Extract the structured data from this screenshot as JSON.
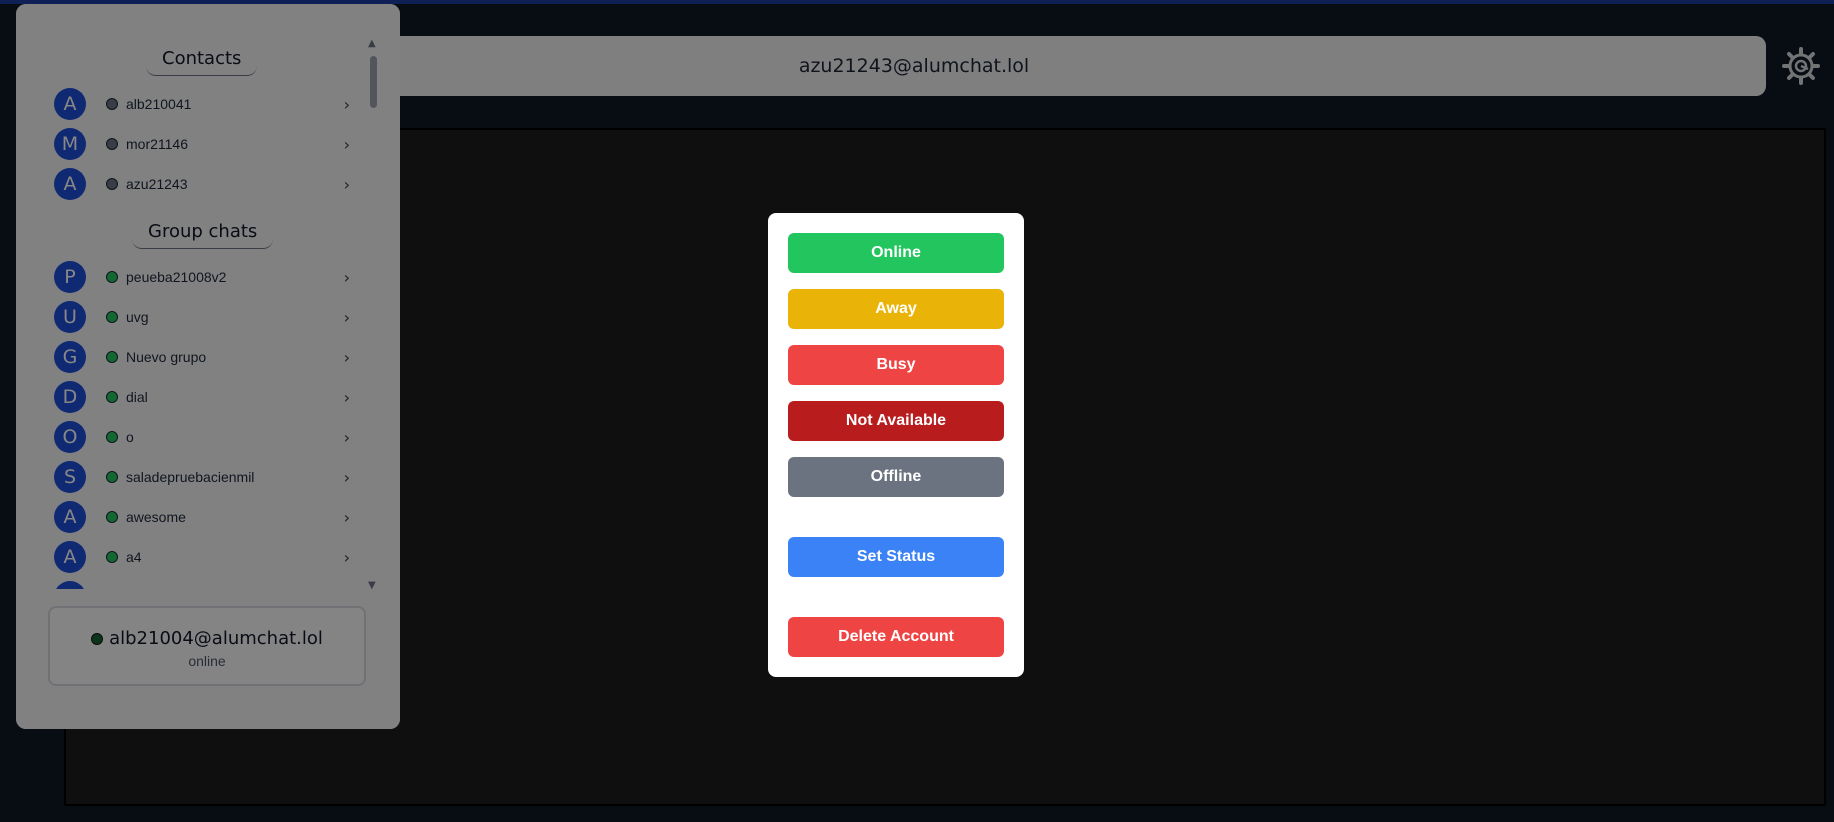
{
  "header": {
    "title": "azu21243@alumchat.lol"
  },
  "sidebar": {
    "contacts_title": "Contacts",
    "groups_title": "Group chats",
    "contacts": [
      {
        "initial": "A",
        "name": "alb210041",
        "status": "offline"
      },
      {
        "initial": "M",
        "name": "mor21146",
        "status": "offline"
      },
      {
        "initial": "A",
        "name": "azu21243",
        "status": "offline"
      }
    ],
    "groups": [
      {
        "initial": "P",
        "name": "peueba21008v2",
        "status": "online"
      },
      {
        "initial": "U",
        "name": "uvg",
        "status": "online"
      },
      {
        "initial": "G",
        "name": "Nuevo grupo",
        "status": "online"
      },
      {
        "initial": "D",
        "name": "dial",
        "status": "online"
      },
      {
        "initial": "O",
        "name": "o",
        "status": "online"
      },
      {
        "initial": "S",
        "name": "saladepruebacienmil",
        "status": "online"
      },
      {
        "initial": "A",
        "name": "awesome",
        "status": "online"
      },
      {
        "initial": "A",
        "name": "a4",
        "status": "online"
      }
    ],
    "current_user": {
      "jid": "alb21004@alumchat.lol",
      "status": "online"
    }
  },
  "status_modal": {
    "online_label": "Online",
    "away_label": "Away",
    "busy_label": "Busy",
    "not_available_label": "Not Available",
    "offline_label": "Offline",
    "set_status_label": "Set Status",
    "delete_account_label": "Delete Account"
  },
  "colors": {
    "online": "#22c55e",
    "away": "#eab308",
    "busy": "#ef4444",
    "not_available": "#b91c1c",
    "offline": "#6b7280",
    "set_status": "#3b82f6",
    "delete_account": "#ef4444",
    "avatar": "#1d4ed8",
    "accent": "#1e40af"
  },
  "icons": {
    "settings": "gear-icon",
    "chevron": "chevron-right-icon"
  }
}
